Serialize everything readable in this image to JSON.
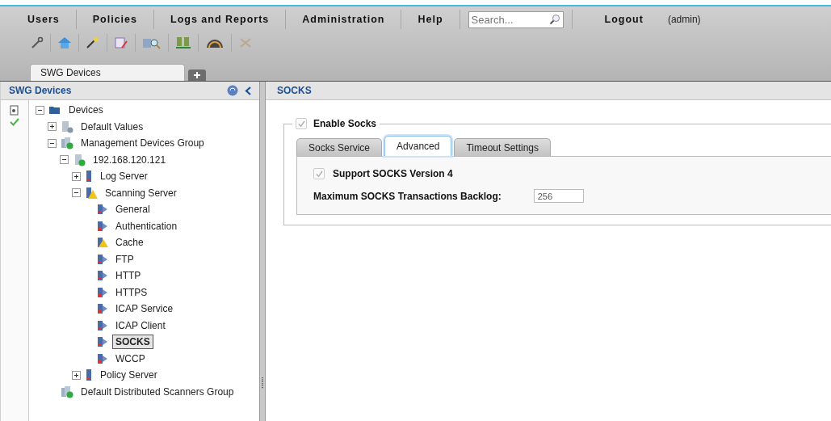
{
  "menu": {
    "items": [
      "Users",
      "Policies",
      "Logs and Reports",
      "Administration",
      "Help"
    ],
    "search": {
      "placeholder": "Search..."
    },
    "logout": "Logout",
    "user": "(admin)"
  },
  "tabs": [
    {
      "label": "SWG Devices",
      "selected": true
    }
  ],
  "sidebar": {
    "title": "SWG Devices",
    "tree": [
      {
        "label": "Devices",
        "kind": "folder",
        "expanded": true,
        "selected": false,
        "children": [
          {
            "label": "Default Values",
            "kind": "defaults",
            "expanded": false,
            "selected": false
          },
          {
            "label": "Management Devices Group",
            "kind": "group",
            "expanded": true,
            "selected": false,
            "children": [
              {
                "label": "192.168.120.121",
                "kind": "device",
                "expanded": true,
                "selected": false,
                "children": [
                  {
                    "label": "Log Server",
                    "kind": "server",
                    "expanded": false,
                    "selected": false
                  },
                  {
                    "label": "Scanning Server",
                    "kind": "warning-server",
                    "expanded": true,
                    "selected": false,
                    "children": [
                      {
                        "label": "General",
                        "kind": "module",
                        "selected": false
                      },
                      {
                        "label": "Authentication",
                        "kind": "module",
                        "selected": false
                      },
                      {
                        "label": "Cache",
                        "kind": "warning-module",
                        "selected": false
                      },
                      {
                        "label": "FTP",
                        "kind": "module",
                        "selected": false
                      },
                      {
                        "label": "HTTP",
                        "kind": "module",
                        "selected": false
                      },
                      {
                        "label": "HTTPS",
                        "kind": "module",
                        "selected": false
                      },
                      {
                        "label": "ICAP Service",
                        "kind": "module",
                        "selected": false
                      },
                      {
                        "label": "ICAP Client",
                        "kind": "module",
                        "selected": false
                      },
                      {
                        "label": "SOCKS",
                        "kind": "module",
                        "selected": true
                      },
                      {
                        "label": "WCCP",
                        "kind": "module",
                        "selected": false
                      }
                    ]
                  },
                  {
                    "label": "Policy Server",
                    "kind": "server",
                    "expanded": false,
                    "selected": false
                  }
                ]
              }
            ]
          },
          {
            "label": "Default Distributed Scanners Group",
            "kind": "group",
            "selected": false
          }
        ]
      }
    ]
  },
  "content": {
    "title": "SOCKS",
    "enable": {
      "label": "Enable Socks",
      "checked": true
    },
    "tabs": [
      {
        "label": "Socks Service",
        "selected": false
      },
      {
        "label": "Advanced",
        "selected": true
      },
      {
        "label": "Timeout Settings",
        "selected": false
      }
    ],
    "support_v4": {
      "label": "Support SOCKS Version 4",
      "checked": true
    },
    "backlog": {
      "label": "Maximum SOCKS Transactions Backlog:",
      "value": "256"
    }
  }
}
